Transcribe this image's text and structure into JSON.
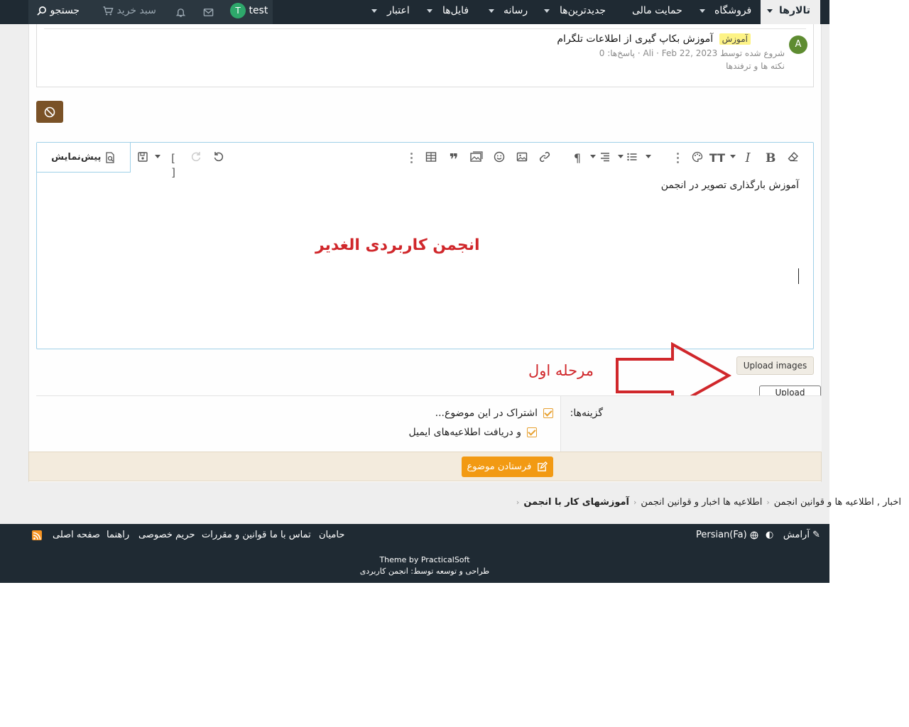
{
  "nav": {
    "forums": "تالارها",
    "store": "فروشگاه",
    "donate": "حمایت مالی",
    "newest": "جدیدترین‌ها",
    "media": "رسانه",
    "files": "فایل‌ها",
    "credit": "اعتبار",
    "username": "test",
    "avatar_letter": "T",
    "cart": "سبد خرید",
    "search": "جستجو"
  },
  "thread": {
    "avatar_letter": "A",
    "prefix": "آموزش",
    "title": "آموزش بکاپ گیری از اطلاعات تلگرام",
    "meta": "شروع شده توسط Ali · Feb 22, 2023 · پاسخ‌ها: 0",
    "forum": "نکته ها و ترفندها"
  },
  "editor": {
    "preview_label": "پیش‌نمایش",
    "body_text": "آموزش بارگذاری تصویر در انجمن",
    "watermark": "انجمن کاربردی الغدیر"
  },
  "upload": {
    "button_label": "Upload images",
    "tooltip": "Upload images",
    "step_label": "مرحله اول"
  },
  "options": {
    "label": "گزینه‌ها:",
    "watch": "اشتراک در این موضوع...",
    "email": "و دریافت اطلاعیه‌های ایمیل"
  },
  "submit": {
    "label": "فرستادن موضوع"
  },
  "breadcrumb": {
    "item1": "اخبار , اطلاعیه ها و قوانین انجمن",
    "item2": "اطلاعیه ها اخبار و قوانین انجمن",
    "item3": "آموزشهای کار با انجمن"
  },
  "footer": {
    "style": "آرامش",
    "language": "Persian(Fa)",
    "sponsors": "حامیان",
    "contact": "تماس با ما",
    "rules": "قوانین و مقررات",
    "privacy": "حریم خصوصی",
    "help": "راهنما",
    "home": "صفحه اصلی",
    "theme_credit": "Theme by PracticalSoft",
    "dev_credit": "طراحی و توسعه توسط: انجمن کاربردی"
  },
  "colors": {
    "nav_bg": "#1f2a33",
    "accent_orange": "#f29a13",
    "annotation_red": "#d0272b",
    "ban_button": "#7a5227"
  }
}
